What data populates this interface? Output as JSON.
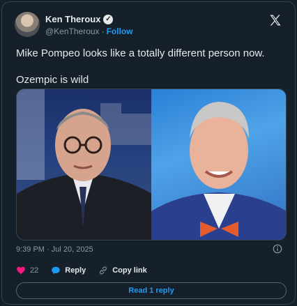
{
  "author": {
    "name": "Ken Theroux",
    "handle": "@KenTheroux",
    "separator": "·",
    "follow_label": "Follow"
  },
  "tweet": {
    "line1": "Mike Pompeo looks like a totally different person now.",
    "line2": "Ozempic is wild"
  },
  "meta": {
    "timestamp": "9:39 PM · Jul 20, 2025"
  },
  "actions": {
    "likes_count": "22",
    "reply_label": "Reply",
    "copy_link_label": "Copy link"
  },
  "read_replies_label": "Read 1 reply",
  "icons": [
    "verified-icon",
    "x-logo-icon",
    "info-icon",
    "heart-icon",
    "reply-icon",
    "link-icon"
  ],
  "colors": {
    "background": "#15202b",
    "accent": "#1d9bf0",
    "like": "#f91880",
    "muted": "#8b98a5",
    "border": "#38444d"
  }
}
